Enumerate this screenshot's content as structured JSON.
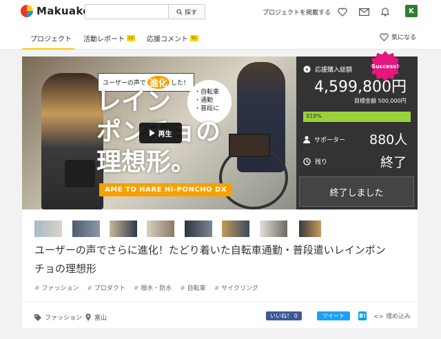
{
  "header": {
    "logo_text": "Makuake",
    "search_placeholder": "",
    "search_button": "探す",
    "post_project": "プロジェクトを掲載する",
    "user_icon_letter": "K",
    "icons": [
      "heart-icon",
      "mail-icon",
      "bell-icon"
    ]
  },
  "tabs": {
    "project": "プロジェクト",
    "activity": "活動レポート",
    "activity_count": "10",
    "comments": "応援コメント",
    "comments_count": "91",
    "favorite": "気になる"
  },
  "hero": {
    "subtitle_prefix": "ユーザーの声で",
    "subtitle_highlight": "進化",
    "subtitle_suffix": "した！",
    "bullets": [
      "・自転車",
      "・通勤",
      "・普段に"
    ],
    "headline_lines": [
      "レイン",
      "ポンチョの",
      "理想形。"
    ],
    "play_label": "再生",
    "brand_bar": "AME TO HARE HI-PONCHO DX"
  },
  "stats": {
    "total_label": "応援購入総額",
    "total_amount": "4,599,800円",
    "goal_label": "目標金額",
    "goal_amount": "500,000円",
    "percent_text": "919%",
    "progress_fraction": 1.0,
    "supporters_label": "サポーター",
    "supporters_value": "880人",
    "remaining_label": "残り",
    "remaining_value": "終了",
    "ended_button": "終了しました",
    "success_badge": "Success!"
  },
  "project": {
    "title_line1": "ユーザーの声でさらに進化！たどり着いた自転車通勤・普段遣いレインポン",
    "title_line2": "チョの理想形",
    "tags": [
      "ファッション",
      "プロダクト",
      "撥水・防水",
      "自転車",
      "サイクリング"
    ]
  },
  "footer": {
    "category": "ファッション",
    "location": "富山",
    "fb_like": "いいね！ 0",
    "tweet": "ツイート",
    "hatena": "B!",
    "embed": "埋め込み"
  },
  "colors": {
    "accent_yellow": "#ffcc00",
    "progress_green": "#9ad13a",
    "success_pink": "#e6157f",
    "brand_orange": "#f8a000"
  }
}
